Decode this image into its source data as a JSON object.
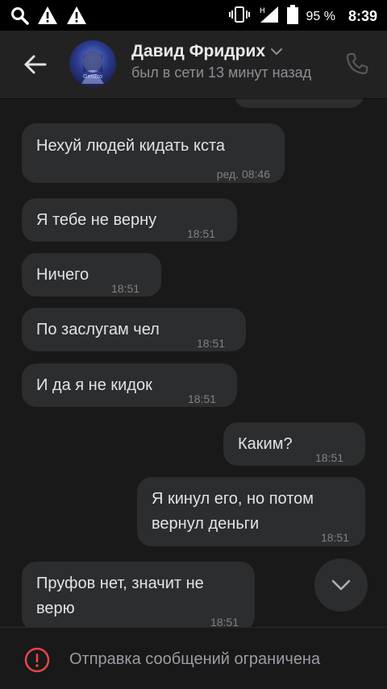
{
  "status_bar": {
    "battery": "95 %",
    "time": "8:39"
  },
  "header": {
    "contact_name": "Давид Фридрих",
    "last_seen": "был в сети 13 минут назад",
    "avatar_label": "GenZro"
  },
  "messages": [
    {
      "text": "Нехуй людей кидать кста",
      "time": "ред. 08:46",
      "side": "in"
    },
    {
      "text": "Я тебе не верну",
      "time": "18:51",
      "side": "in"
    },
    {
      "text": "Ничего",
      "time": "18:51",
      "side": "in"
    },
    {
      "text": "По заслугам чел",
      "time": "18:51",
      "side": "in"
    },
    {
      "text": "И да я не кидок",
      "time": "18:51",
      "side": "in"
    },
    {
      "text": "Каким?",
      "time": "18:51",
      "side": "out"
    },
    {
      "text_line1": "Я кинул его, но потом",
      "text_line2": "вернул деньги",
      "time": "18:51",
      "side": "out"
    },
    {
      "text_line1": "Пруфов нет, значит не",
      "text_line2": "верю",
      "time": "18:51",
      "side": "in"
    }
  ],
  "footer": {
    "notice": "Отправка сообщений ограничена"
  },
  "icons": {
    "search": "search-icon",
    "warning": "warning-triangle-icon",
    "vibrate": "vibrate-icon",
    "signal": "signal-icon",
    "battery": "battery-icon",
    "back": "arrow-back-icon",
    "chevron": "chevron-down-icon",
    "call": "phone-icon",
    "scroll_down": "chevron-down-icon",
    "restricted": "exclamation-circle-icon"
  },
  "colors": {
    "background": "#19191a",
    "bubble": "#2c2d2e",
    "header": "#222223",
    "warning_red": "#e64646"
  }
}
